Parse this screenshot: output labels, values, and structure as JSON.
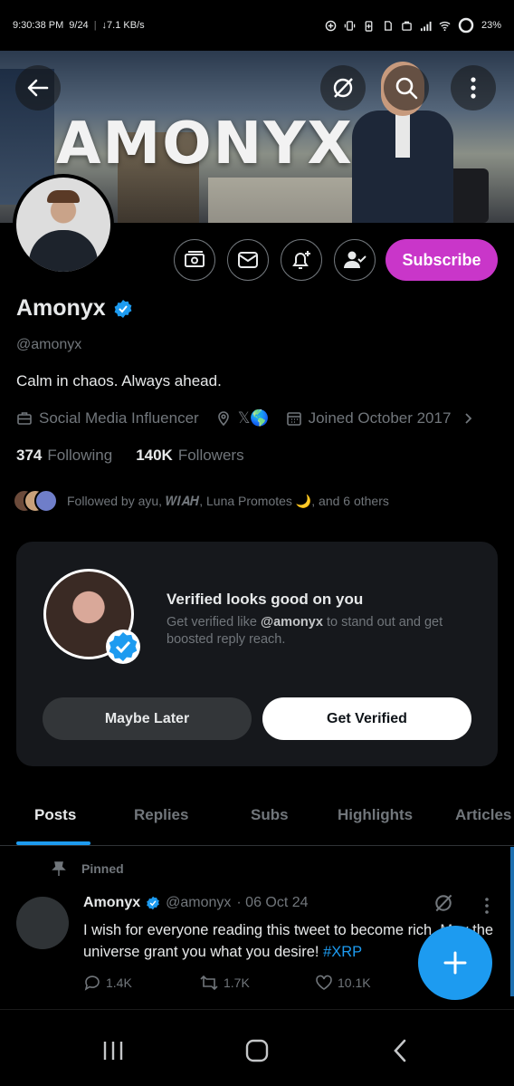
{
  "status": {
    "time": "9:30:38 PM",
    "date": "9/24",
    "speed": "↓7.1 KB/s",
    "battery": "23%"
  },
  "banner": {
    "title": "AMONYX"
  },
  "profile": {
    "name": "Amonyx",
    "handle": "@amonyx",
    "bio": "Calm in chaos. Always ahead.",
    "category": "Social Media Influencer",
    "location": "𝕏🌎",
    "joined": "Joined October 2017",
    "following_count": "374",
    "following_label": "Following",
    "followers_count": "140K",
    "followers_label": "Followers",
    "subscribe_label": "Subscribe",
    "followed_by": "Followed by ayu, 𝑾𝑰𝑨𝑯, Luna Promotes 🌙, and 6 others"
  },
  "verify_card": {
    "heading": "Verified looks good on you",
    "text_prefix": "Get verified like ",
    "text_handle": "@amonyx",
    "text_suffix": " to stand out and get boosted reply reach.",
    "maybe_label": "Maybe Later",
    "get_label": "Get Verified"
  },
  "tabs": [
    "Posts",
    "Replies",
    "Subs",
    "Highlights",
    "Articles"
  ],
  "tweet": {
    "pinned_label": "Pinned",
    "author": "Amonyx",
    "handle": "@amonyx",
    "date": "· 06 Oct 24",
    "text": "I wish for everyone reading this tweet to become rich. May the universe grant you what you desire! ",
    "hashtag": "#XRP",
    "replies": "1.4K",
    "reposts": "1.7K",
    "likes": "10.1K"
  },
  "colors": {
    "accent": "#1d9bf0",
    "subscribe": "#c936c9",
    "muted": "#71767b"
  }
}
